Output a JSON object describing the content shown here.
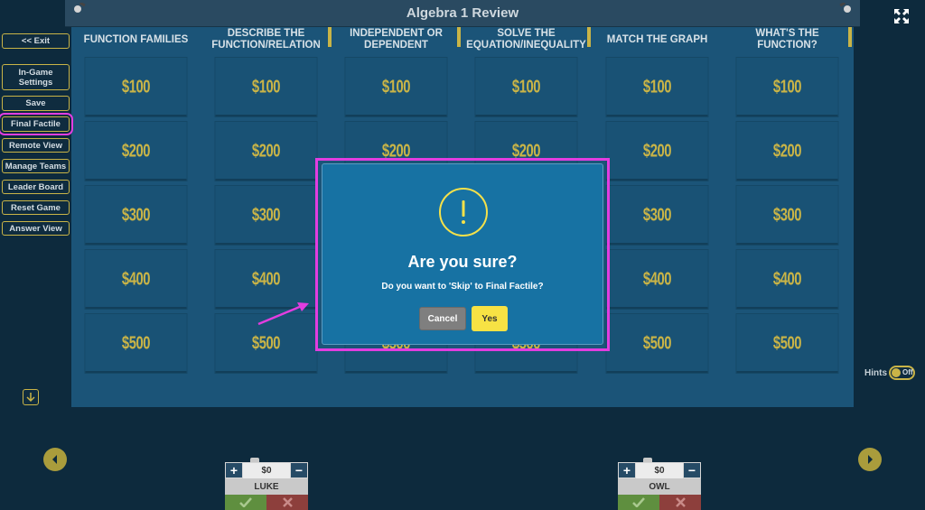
{
  "header": {
    "title": "Algebra 1 Review"
  },
  "categories": [
    "FUNCTION FAMILIES",
    "DESCRIBE THE FUNCTION/RELATION",
    "INDEPENDENT OR DEPENDENT",
    "SOLVE THE EQUATION/INEQUALITY",
    "MATCH THE GRAPH",
    "WHAT'S THE FUNCTION?"
  ],
  "values": [
    "$100",
    "$200",
    "$300",
    "$400",
    "$500"
  ],
  "sidebar": {
    "items": [
      "<< Exit",
      "In-Game Settings",
      "Save",
      "Final Factile",
      "Remote View",
      "Manage Teams",
      "Leader Board",
      "Reset Game",
      "Answer View"
    ]
  },
  "hints": {
    "label": "Hints",
    "state": "Off"
  },
  "teams": [
    {
      "score": "$0",
      "name": "LUKE"
    },
    {
      "score": "$0",
      "name": "OWL"
    }
  ],
  "modal": {
    "title": "Are you sure?",
    "message": "Do you want to 'Skip' to Final Factile?",
    "cancel_label": "Cancel",
    "yes_label": "Yes"
  },
  "colors": {
    "accent_gold": "#c9b447",
    "modal_blue": "#1772a3",
    "highlight_magenta": "#e23de0",
    "yes_yellow": "#f7e244"
  },
  "icons": [
    "pin-icon",
    "expand-icon",
    "exclamation-icon",
    "arrow-down-icon",
    "chevron-left-icon",
    "chevron-right-icon",
    "plus-icon",
    "minus-icon",
    "check-icon",
    "x-icon"
  ]
}
